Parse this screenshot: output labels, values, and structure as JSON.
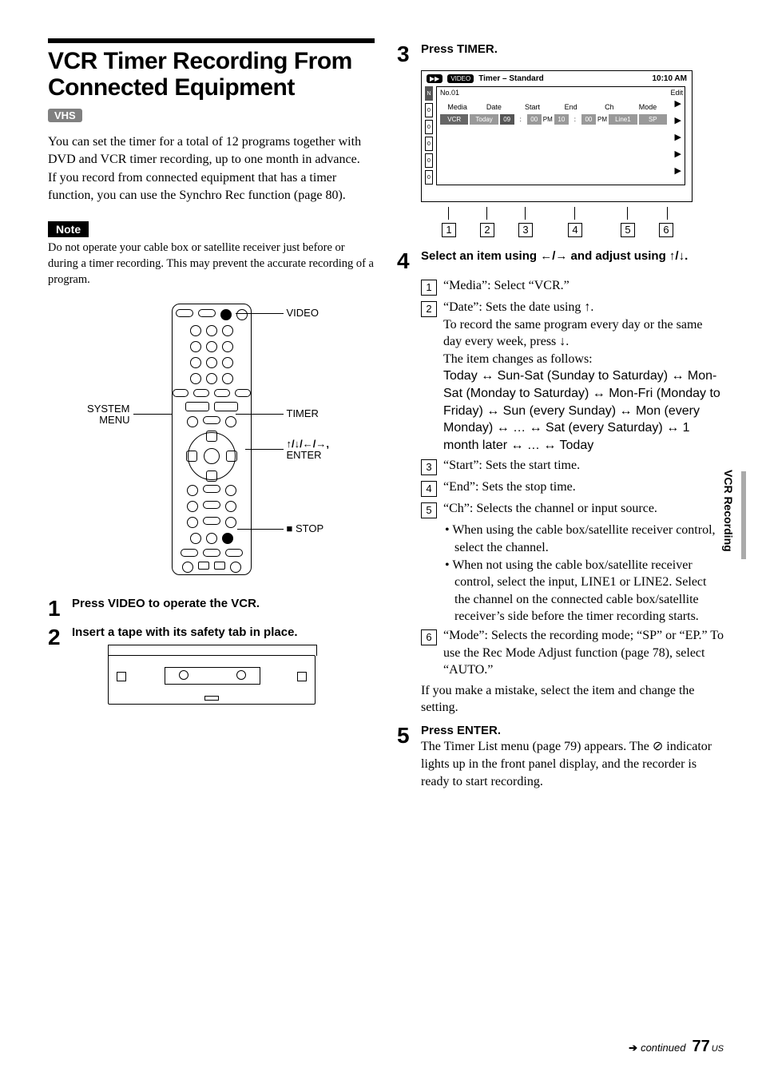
{
  "title": "VCR Timer Recording From Connected Equipment",
  "badge": "VHS",
  "intro1": "You can set the timer for a total of 12 programs together with DVD and VCR timer recording, up to one month in advance.",
  "intro2": "If you record from connected equipment that has a timer function, you can use the Synchro Rec function (page 80).",
  "note_label": "Note",
  "note_text": "Do not operate your cable box or satellite receiver just before or during a timer recording. This may prevent the accurate recording of a program.",
  "remote": {
    "video": "VIDEO",
    "system_menu1": "SYSTEM",
    "system_menu2": "MENU",
    "timer": "TIMER",
    "dpad": "↑/↓/←/→,",
    "enter": "ENTER",
    "stop": "■ STOP"
  },
  "steps": {
    "s1": "Press VIDEO to operate the VCR.",
    "s2": "Insert a tape with its safety tab in place.",
    "s3": "Press TIMER.",
    "s4a": "Select an item using ",
    "s4b": " and adjust using ",
    "s5a": "Press ENTER.",
    "s5b": "The Timer List menu (page 79) appears. The ⊘ indicator lights up in the front panel display, and the recorder is ready to start recording."
  },
  "osd": {
    "pill1": "▶▶",
    "pill2": "VIDEO",
    "title": "Timer – Standard",
    "time": "10:10 AM",
    "no": "No.01",
    "edit": "Edit",
    "heads": {
      "media": "Media",
      "date": "Date",
      "start": "Start",
      "end": "End",
      "ch": "Ch",
      "mode": "Mode"
    },
    "row": {
      "media": "VCR",
      "date": "Today",
      "sh": "09",
      "sc": ":",
      "sm": "00",
      "sap": "PM",
      "eh": "10",
      "ec": ":",
      "em": "00",
      "eap": "PM",
      "ch": "Line1",
      "mode": "SP"
    }
  },
  "defs": {
    "d1": "“Media”: Select “VCR.”",
    "d2a": "“Date”: Sets the date using ↑.",
    "d2b": "To record the same program every day or the same day every week, press ↓.",
    "d2c": "The item changes as follows:",
    "d2d": "Today ↔ Sun-Sat (Sunday to Saturday) ↔ Mon-Sat (Monday to Saturday) ↔ Mon-Fri (Monday to Friday) ↔ Sun (every Sunday) ↔ Mon (every Monday) ↔ … ↔ Sat (every Saturday) ↔ 1 month later ↔ … ↔ Today",
    "d3": "“Start”: Sets the start time.",
    "d4": "“End”: Sets the stop time.",
    "d5": "“Ch”: Selects the channel or input source.",
    "d5b1": "When using the cable box/satellite receiver control, select the channel.",
    "d5b2": "When not using the cable box/satellite receiver control, select the input, LINE1 or LINE2. Select the channel on the connected cable box/satellite receiver’s side before the timer recording starts.",
    "d6": "“Mode”: Selects the recording mode; “SP” or “EP.” To use the Rec Mode Adjust function (page 78), select “AUTO.”",
    "tail": "If you make a mistake, select the item and change the setting."
  },
  "side": "VCR Recording",
  "footer": {
    "cont": "continued",
    "page": "77",
    "region": "US"
  }
}
